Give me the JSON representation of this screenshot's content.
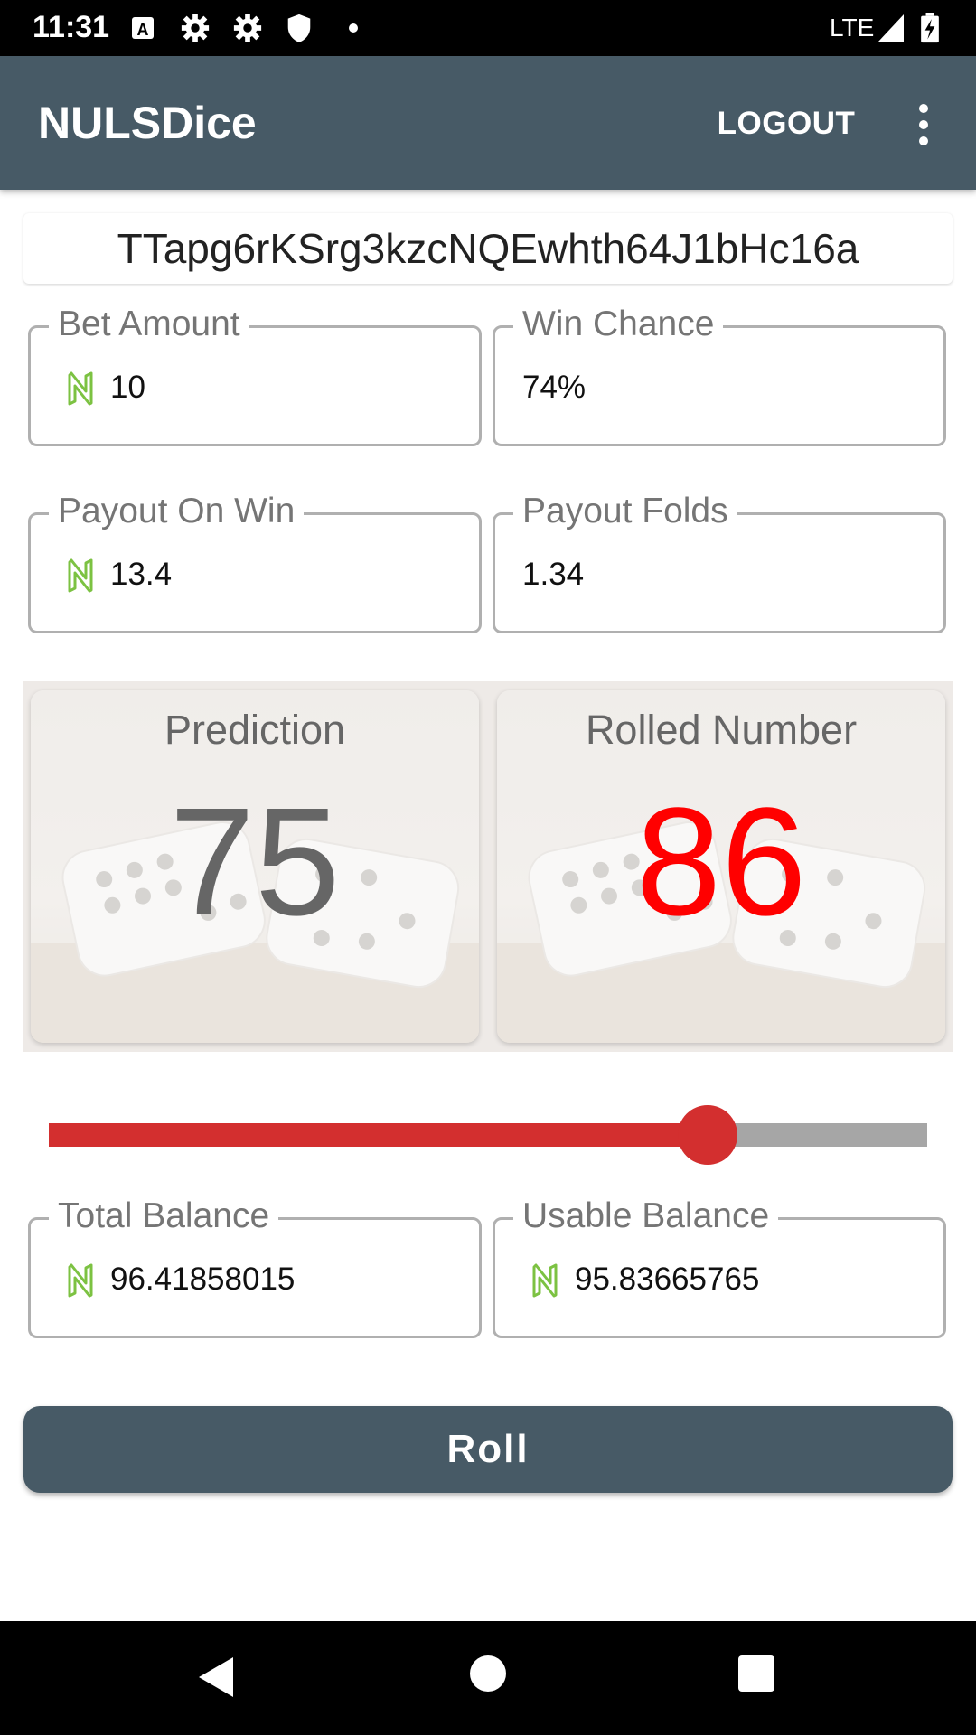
{
  "status_bar": {
    "time": "11:31",
    "network": "LTE",
    "icons": [
      "text-a-icon",
      "gear-icon",
      "gear-icon",
      "shield-icon",
      "dot-icon",
      "signal-icon",
      "battery-charging-icon"
    ]
  },
  "app_bar": {
    "title": "NULSDice",
    "logout_label": "LOGOUT",
    "overflow_icon": "more-vert-icon",
    "color": "#475a66"
  },
  "address": "TTapg6rKSrg3kzcNQEwhth64J1bHc16a",
  "fields": {
    "bet_amount": {
      "label": "Bet Amount",
      "value": "10",
      "icon": "nuls-icon"
    },
    "win_chance": {
      "label": "Win Chance",
      "value": "74%"
    },
    "payout_on_win": {
      "label": "Payout On Win",
      "value": "13.4",
      "icon": "nuls-icon"
    },
    "payout_folds": {
      "label": "Payout Folds",
      "value": "1.34"
    },
    "total_balance": {
      "label": "Total Balance",
      "value": "96.41858015",
      "icon": "nuls-icon"
    },
    "usable_balance": {
      "label": "Usable Balance",
      "value": "95.83665765",
      "icon": "nuls-icon"
    }
  },
  "prediction": {
    "title": "Prediction",
    "value": "75",
    "color": "#666666"
  },
  "rolled": {
    "title": "Rolled Number",
    "value": "86",
    "color": "#ff0000"
  },
  "slider": {
    "value_fraction": 0.75,
    "active_color": "#d32f2f",
    "inactive_color": "#a6a6a6"
  },
  "roll_button": {
    "label": "Roll"
  },
  "nav_bar": {
    "icons": [
      "back-icon",
      "home-icon",
      "recents-icon"
    ]
  }
}
